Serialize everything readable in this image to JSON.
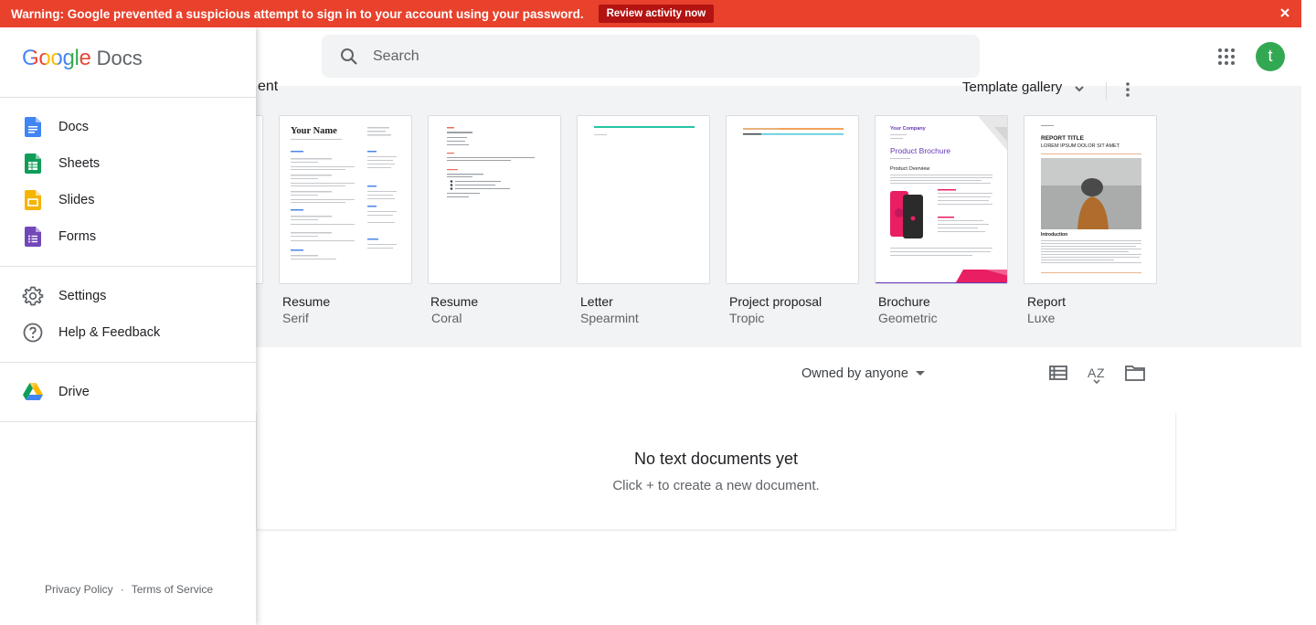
{
  "warning": {
    "message": "Warning: Google prevented a suspicious attempt to sign in to your account using your password.",
    "action_label": "Review activity now"
  },
  "header": {
    "search_placeholder": "Search",
    "avatar_letter": "t",
    "avatar_color": "#33a853"
  },
  "drawer": {
    "brand_google": "Google",
    "brand_app": "Docs",
    "apps": [
      {
        "label": "Docs",
        "icon": "docs-icon"
      },
      {
        "label": "Sheets",
        "icon": "sheets-icon"
      },
      {
        "label": "Slides",
        "icon": "slides-icon"
      },
      {
        "label": "Forms",
        "icon": "forms-icon"
      }
    ],
    "settings_items": [
      {
        "label": "Settings",
        "icon": "gear-icon"
      },
      {
        "label": "Help & Feedback",
        "icon": "help-icon"
      }
    ],
    "drive_label": "Drive",
    "privacy_label": "Privacy Policy",
    "footer_dot": "·",
    "terms_label": "Terms of Service"
  },
  "templates": {
    "section_title_fragment": "ent",
    "gallery_label": "Template gallery",
    "items": [
      {
        "name": "Resume",
        "style": "Serif"
      },
      {
        "name": "Resume",
        "style": "Coral"
      },
      {
        "name": "Letter",
        "style": "Spearmint"
      },
      {
        "name": "Project proposal",
        "style": "Tropic"
      },
      {
        "name": "Brochure",
        "style": "Geometric"
      },
      {
        "name": "Report",
        "style": "Luxe"
      }
    ],
    "thumb_text": {
      "resume_serif_name": "Your Name",
      "brochure_company": "Your Company",
      "brochure_title": "Product Brochure",
      "brochure_overview": "Product Overview",
      "report_title": "REPORT TITLE",
      "report_subtitle": "LOREM IPSUM DOLOR SIT AMET",
      "report_intro": "Introduction"
    }
  },
  "list": {
    "owner_filter": "Owned by anyone",
    "empty_title": "No text documents yet",
    "empty_subtitle": "Click + to create a new document."
  }
}
